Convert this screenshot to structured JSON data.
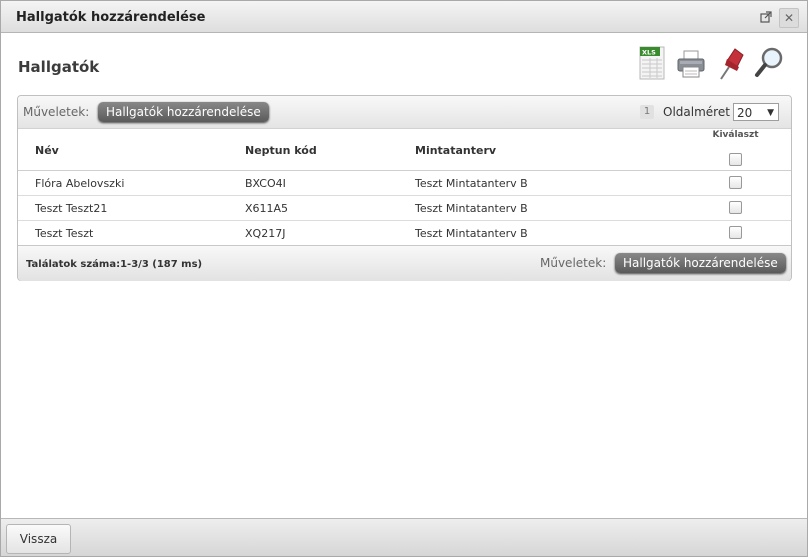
{
  "window": {
    "title": "Hallgatók hozzárendelése"
  },
  "toolbar_icons": [
    "xls-export-icon",
    "print-icon",
    "pin-icon",
    "search-icon"
  ],
  "section": {
    "heading": "Hallgatók"
  },
  "panel": {
    "ops_label_top": "Műveletek:",
    "assign_button_top": "Hallgatók hozzárendelése",
    "current_page": "1",
    "page_size_label": "Oldalméret",
    "page_size_value": "20",
    "columns": {
      "name": "Név",
      "neptun": "Neptun kód",
      "curriculum": "Mintatanterv",
      "select": "Kiválaszt"
    },
    "rows": [
      {
        "name": "Flóra Abelovszki",
        "neptun": "BXCO4I",
        "curriculum": "Teszt Mintatanterv B"
      },
      {
        "name": "Teszt Teszt21",
        "neptun": "X611A5",
        "curriculum": "Teszt Mintatanterv B"
      },
      {
        "name": "Teszt Teszt",
        "neptun": "XQ217J",
        "curriculum": "Teszt Mintatanterv B"
      }
    ],
    "results_text": "Találatok száma:1-3/3 (187 ms)",
    "ops_label_bottom": "Műveletek:",
    "assign_button_bottom": "Hallgatók hozzárendelése"
  },
  "footer": {
    "back_button": "Vissza"
  }
}
